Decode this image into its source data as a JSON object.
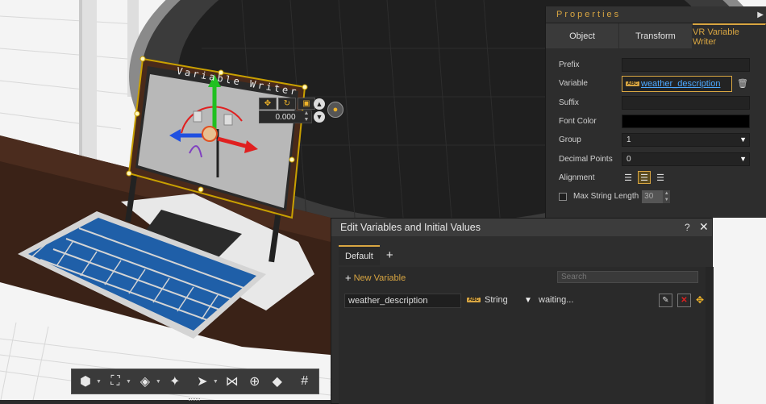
{
  "viewport": {
    "screen_text": "Variable Writer",
    "gizmo_value": "0.000",
    "toolbar_icons": [
      "view-cube-icon",
      "frame-icon",
      "shading-icon",
      "light-icon",
      "select-cursor-icon",
      "snap-icon",
      "zoom-search-icon",
      "grid-plane-icon",
      "grid-icon",
      "drop-to-floor-icon"
    ]
  },
  "properties": {
    "title": "Properties",
    "tabs": [
      {
        "label": "Object",
        "active": false
      },
      {
        "label": "Transform",
        "active": false
      },
      {
        "label": "VR Variable Writer",
        "active": true
      }
    ],
    "prefix_label": "Prefix",
    "variable_label": "Variable",
    "variable_badge": "ABC",
    "variable_value": "weather_description",
    "suffix_label": "Suffix",
    "font_color_label": "Font Color",
    "font_color_value": "#000000",
    "group_label": "Group",
    "group_value": "1",
    "decimal_points_label": "Decimal Points",
    "decimal_points_value": "0",
    "alignment_label": "Alignment",
    "alignment_selected": "center",
    "max_string_length_label": "Max String Length",
    "max_string_length_value": "30",
    "max_string_length_checked": false
  },
  "edit_dialog": {
    "title": "Edit Variables and Initial Values",
    "help": "?",
    "close": "✕",
    "tabs": [
      {
        "label": "Default"
      }
    ],
    "add_tab": "+",
    "new_variable_label": "New Variable",
    "search_placeholder": "Search",
    "variables": [
      {
        "name": "weather_description",
        "type_badge": "ABC",
        "type": "String",
        "initial_value": "waiting..."
      }
    ]
  },
  "colors": {
    "accent": "#d9a642",
    "link": "#4ca8ff",
    "panel_bg": "#2d2d2d",
    "delete": "#e02020"
  }
}
